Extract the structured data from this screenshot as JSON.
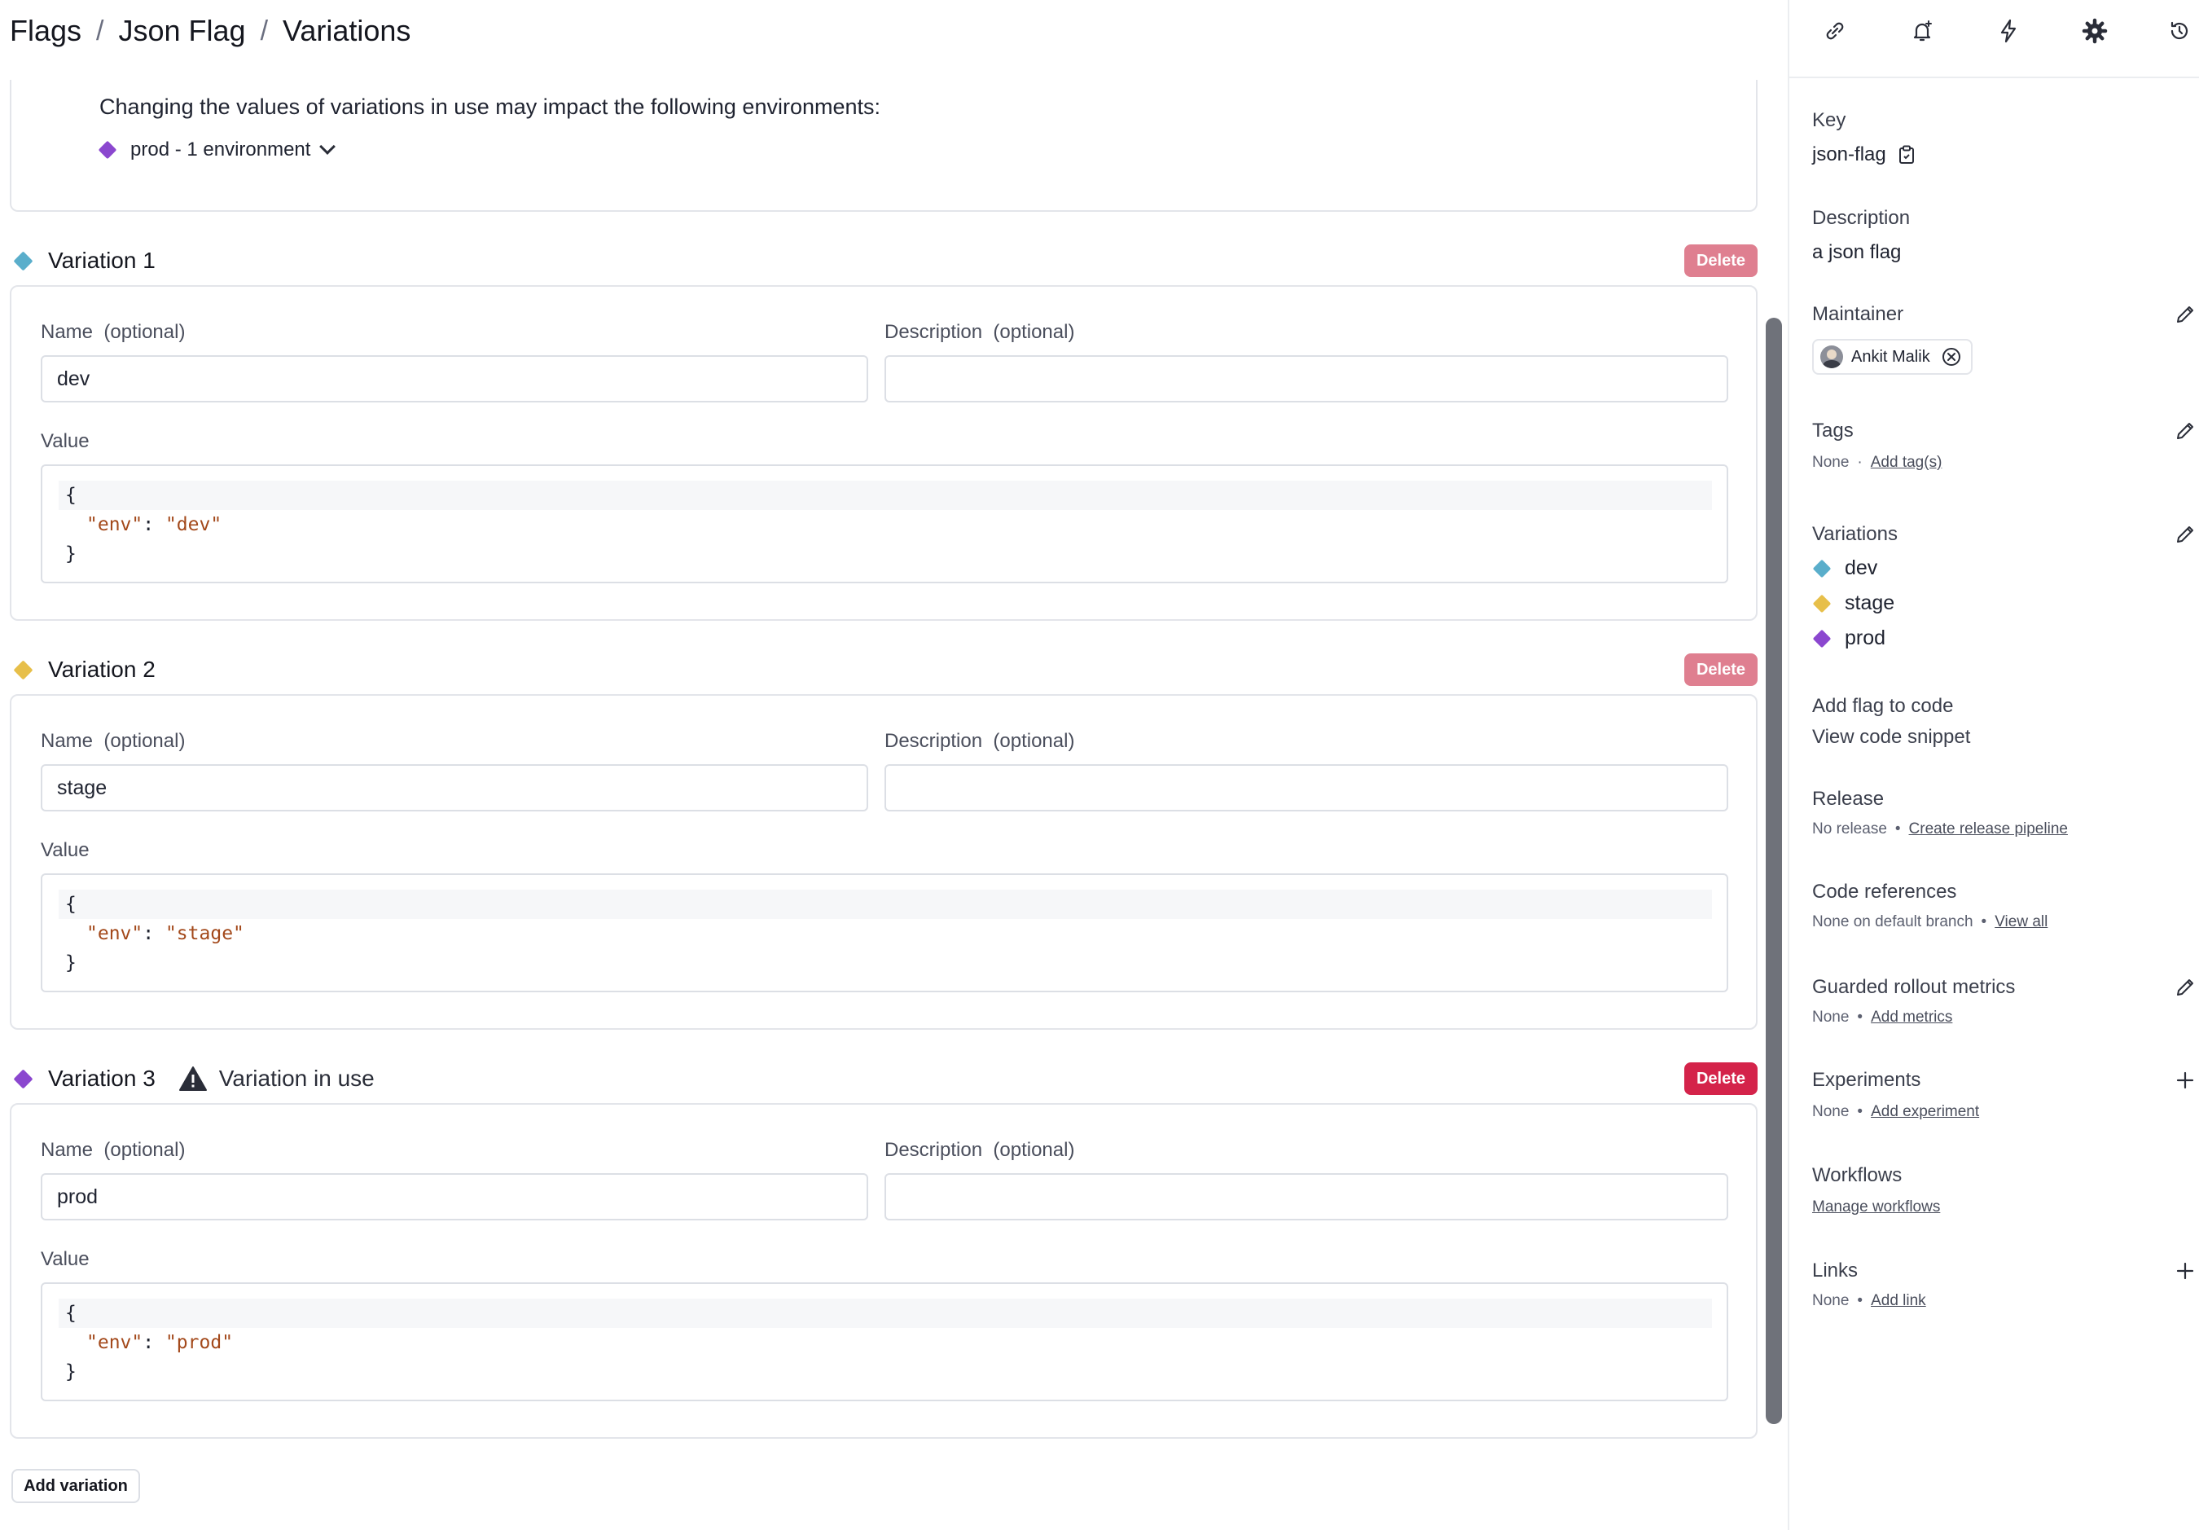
{
  "breadcrumb": {
    "items": [
      "Flags",
      "Json Flag",
      "Variations"
    ],
    "separator": "/"
  },
  "impact": {
    "message": "Changing the values of variations in use may impact the following environments:",
    "env_label": "prod - 1 environment"
  },
  "variations": [
    {
      "title": "Variation 1",
      "color": "#5aaecb",
      "in_use": false,
      "delete_label": "Delete",
      "name_label": "Name",
      "name_suffix": "(optional)",
      "name_value": "dev",
      "desc_label": "Description",
      "desc_suffix": "(optional)",
      "desc_value": "",
      "value_label": "Value",
      "code": {
        "open": "{",
        "key": "\"env\"",
        "colon": ": ",
        "val": "\"dev\"",
        "close": "}"
      }
    },
    {
      "title": "Variation 2",
      "color": "#e7bf4a",
      "in_use": false,
      "delete_label": "Delete",
      "name_label": "Name",
      "name_suffix": "(optional)",
      "name_value": "stage",
      "desc_label": "Description",
      "desc_suffix": "(optional)",
      "desc_value": "",
      "value_label": "Value",
      "code": {
        "open": "{",
        "key": "\"env\"",
        "colon": ": ",
        "val": "\"stage\"",
        "close": "}"
      }
    },
    {
      "title": "Variation 3",
      "color": "#8b47cf",
      "in_use": true,
      "in_use_label": "Variation in use",
      "delete_label": "Delete",
      "name_label": "Name",
      "name_suffix": "(optional)",
      "name_value": "prod",
      "desc_label": "Description",
      "desc_suffix": "(optional)",
      "desc_value": "",
      "value_label": "Value",
      "code": {
        "open": "{",
        "key": "\"env\"",
        "colon": ": ",
        "val": "\"prod\"",
        "close": "}"
      }
    }
  ],
  "add_variation_label": "Add variation",
  "toolbar_icons": [
    "link-icon",
    "bell-plus-icon",
    "lightning-icon",
    "gear-icon",
    "history-icon"
  ],
  "side": {
    "key": {
      "title": "Key",
      "value": "json-flag",
      "icon": "clipboard-icon"
    },
    "description": {
      "title": "Description",
      "value": "a json flag"
    },
    "maintainer": {
      "title": "Maintainer",
      "name": "Ankit Malik"
    },
    "tags": {
      "title": "Tags",
      "none": "None",
      "dot": "·",
      "link": "Add tag(s)"
    },
    "variations": {
      "title": "Variations",
      "items": [
        {
          "label": "dev",
          "color": "#5aaecb"
        },
        {
          "label": "stage",
          "color": "#e7bf4a"
        },
        {
          "label": "prod",
          "color": "#8b47cf"
        }
      ]
    },
    "add_flag": {
      "title": "Add flag to code",
      "value": "View code snippet"
    },
    "release": {
      "title": "Release",
      "none": "No release",
      "dot": "•",
      "link": "Create release pipeline"
    },
    "code_refs": {
      "title": "Code references",
      "none": "None on default branch",
      "dot": "•",
      "link": "View all"
    },
    "guarded": {
      "title": "Guarded rollout metrics",
      "none": "None",
      "dot": "•",
      "link": "Add metrics"
    },
    "experiments": {
      "title": "Experiments",
      "none": "None",
      "dot": "•",
      "link": "Add experiment"
    },
    "workflows": {
      "title": "Workflows",
      "link": "Manage workflows"
    },
    "links": {
      "title": "Links",
      "none": "None",
      "dot": "•",
      "link": "Add link"
    }
  },
  "colors": {
    "delete_muted": "#df7f90",
    "delete_active": "#d4234a",
    "json_string": "#a3491b"
  }
}
